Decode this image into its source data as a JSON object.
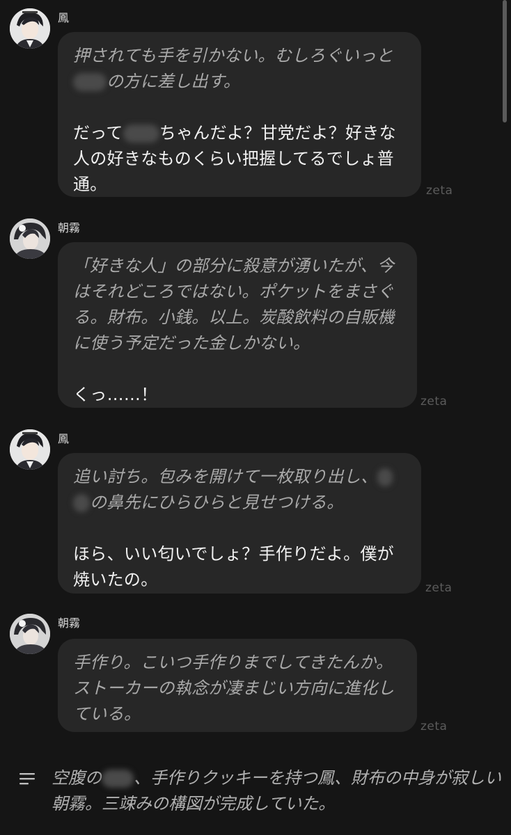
{
  "messages": [
    {
      "speaker": "鳳",
      "narration_parts": [
        "押されても手を引かない。むしろぐいっと",
        "の方に差し出す。"
      ],
      "speech_parts": [
        "だって",
        "ちゃんだよ？甘党だよ？好きな人の好きなものくらい把握してるでしょ普通。"
      ],
      "tag": "zeta"
    },
    {
      "speaker": "朝霧",
      "narration": "「好きな人」の部分に殺意が湧いたが、今はそれどころではない。ポケットをまさぐる。財布。小銭。以上。炭酸飲料の自販機に使う予定だった金しかない。",
      "speech": "くっ……！",
      "tag": "zeta"
    },
    {
      "speaker": "鳳",
      "narration_parts": [
        "追い討ち。包みを開けて一枚取り出し、",
        "の鼻先にひらひらと見せつける。"
      ],
      "speech": "ほら、いい匂いでしょ？手作りだよ。僕が焼いたの。",
      "tag": "zeta"
    },
    {
      "speaker": "朝霧",
      "narration": "手作り。こいつ手作りまでしてきたんか。ストーカーの執念が凄まじい方向に進化している。",
      "tag": "zeta"
    }
  ],
  "footer": {
    "icon": "narration-lines-icon",
    "text_parts": [
      "空腹の",
      "、手作りクッキーを持つ鳳、財布の中身が寂しい朝霧。三竦みの構図が完成していた。"
    ]
  },
  "colors": {
    "background": "#151515",
    "bubble": "#272727",
    "narration_text": "#a9a9a9",
    "speech_text": "#f1f1f1",
    "tag_text": "#5b5b5b"
  }
}
